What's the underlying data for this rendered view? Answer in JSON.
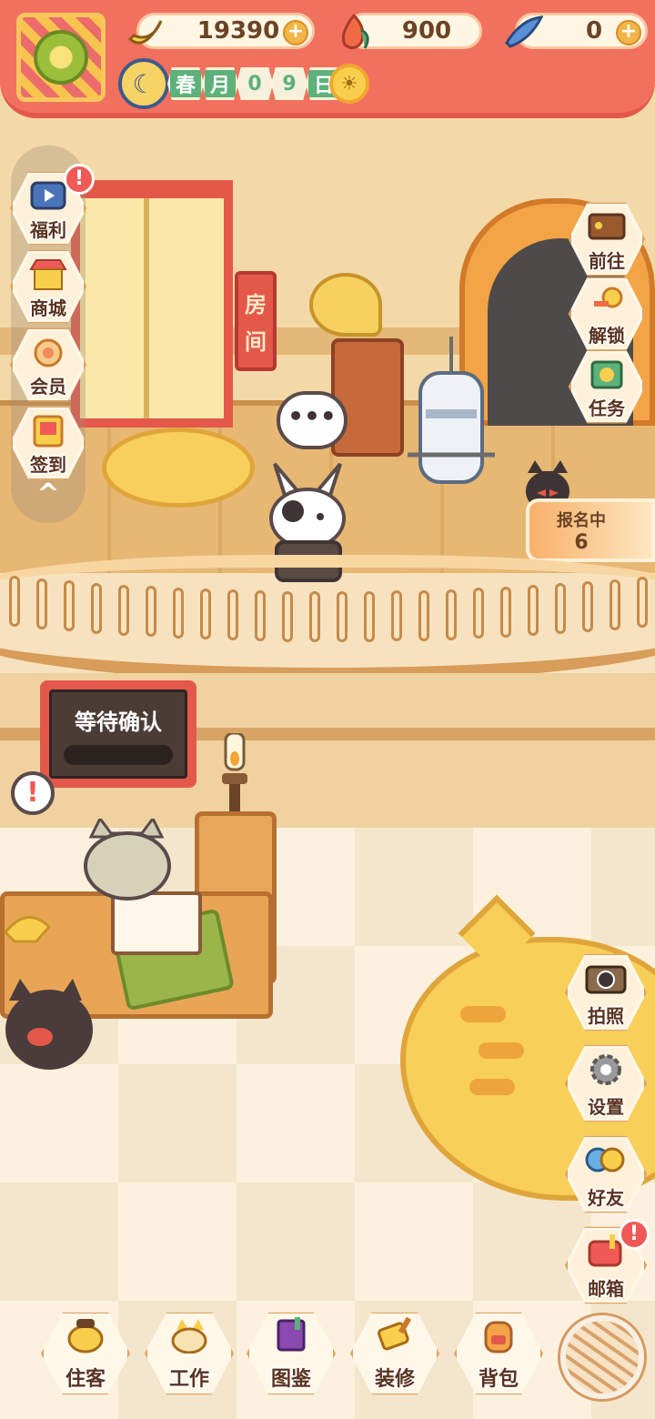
{
  "resources": {
    "banana": {
      "value": "19390",
      "plus": "+"
    },
    "fire": {
      "value": "900"
    },
    "fish": {
      "value": "0",
      "plus": "+"
    }
  },
  "date": {
    "season": "春",
    "month_label": "月",
    "day_tens": "0",
    "day_ones": "9",
    "day_label": "日"
  },
  "left_menu": {
    "items": [
      {
        "label": "福利",
        "badge": "!"
      },
      {
        "label": "商城"
      },
      {
        "label": "会员"
      },
      {
        "label": "签到"
      }
    ],
    "collapse": "^"
  },
  "right_menu_top": {
    "items": [
      {
        "label": "前往"
      },
      {
        "label": "解锁"
      },
      {
        "label": "任务"
      }
    ]
  },
  "event": {
    "status": "报名中",
    "count": "6"
  },
  "room_sign": {
    "char1": "房",
    "char2": "间"
  },
  "speech": "•••",
  "status_board": {
    "text": "等待确认"
  },
  "desk_alert": "!",
  "right_menu_bottom": {
    "items": [
      {
        "label": "拍照"
      },
      {
        "label": "设置"
      },
      {
        "label": "好友"
      },
      {
        "label": "邮箱",
        "badge": "!"
      }
    ]
  },
  "bottom_nav": {
    "items": [
      {
        "label": "住客"
      },
      {
        "label": "工作"
      },
      {
        "label": "图鉴"
      },
      {
        "label": "装修"
      },
      {
        "label": "背包"
      }
    ]
  },
  "colors": {
    "curtain": "#f2715e",
    "accent_green": "#5db17a",
    "badge_red": "#ef5a57",
    "hex_border": "#e0a15e"
  }
}
